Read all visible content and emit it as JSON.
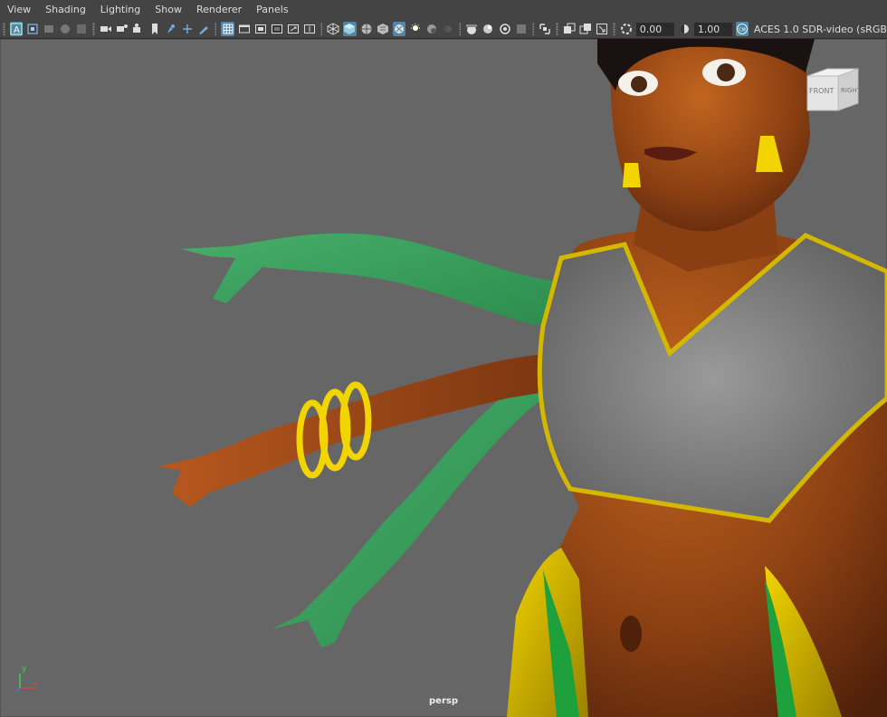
{
  "menubar": {
    "items": [
      "View",
      "Shading",
      "Lighting",
      "Show",
      "Renderer",
      "Panels"
    ]
  },
  "toolbar": {
    "exposure_value": "0.00",
    "gamma_value": "1.00",
    "color_management_label": "ACES 1.0 SDR-video (sRGB",
    "icons": [
      "select-camera-icon",
      "camera-attributes-icon",
      "bookmark-icon",
      "image-plane-icon",
      "grid-icon",
      "film-gate-icon",
      "resolution-gate-icon",
      "gate-mask-icon",
      "field-chart-icon",
      "safe-action-icon",
      "wireframe-icon",
      "smooth-shade-icon",
      "textured-icon",
      "lights-icon",
      "shadows-icon",
      "xray-icon",
      "isolate-icon",
      "exposure-icon",
      "gamma-icon",
      "color-management-icon"
    ],
    "accent": "#5285a6"
  },
  "viewport": {
    "camera_name": "persp",
    "viewcube": {
      "front": "FRONT",
      "right": "RIGHT"
    },
    "axis": {
      "x": "x",
      "y": "y"
    },
    "background": "#666666"
  }
}
